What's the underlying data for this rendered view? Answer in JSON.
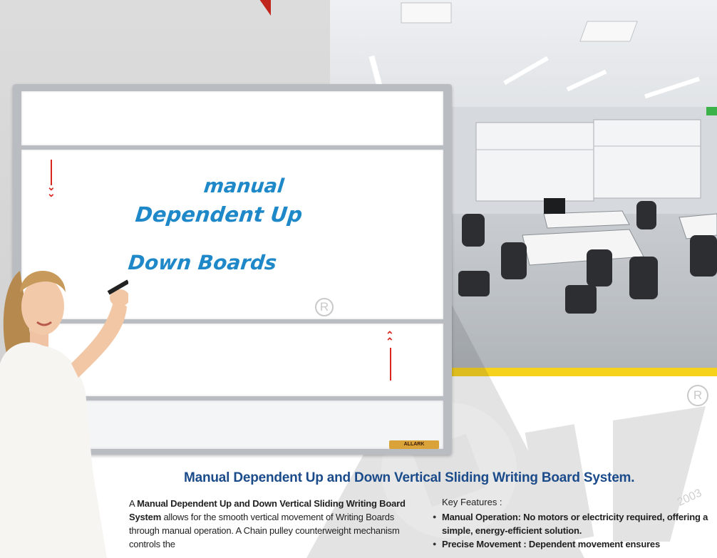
{
  "board": {
    "handwriting": [
      "manual",
      "Dependent Up",
      "Down Boards"
    ],
    "brand_plate": "ALLARK"
  },
  "watermark": {
    "registered_symbol": "R",
    "year": "2003"
  },
  "headline": "Manual Dependent Up and Down Vertical Sliding Writing Board System.",
  "description": {
    "intro": "A ",
    "bold": "Manual Dependent Up and Down Vertical Sliding Writing Board System",
    "rest": " allows for the smooth vertical movement of Writing Boards through manual operation. A Chain pulley counterweight mechanism controls the"
  },
  "features": {
    "title": "Key Features :",
    "items": [
      "Manual Operation: No motors or electricity required, offering a simple, energy-efficient solution.",
      "Precise Movement : Dependent movement ensures"
    ]
  },
  "colors": {
    "accent_blue": "#1b4b8a",
    "marker_blue": "#1e88c8",
    "arrow_red": "#d8271f",
    "band_yellow": "#f7d21c"
  }
}
